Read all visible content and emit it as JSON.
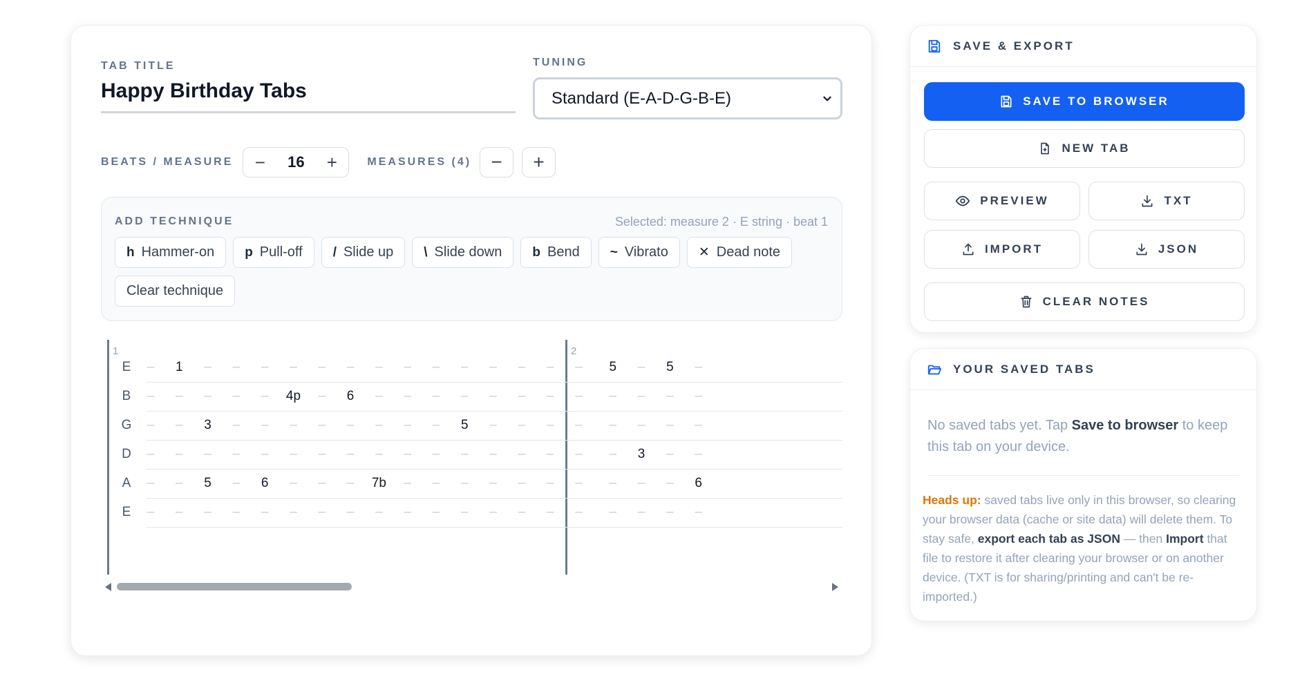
{
  "editor": {
    "title_label": "TAB TITLE",
    "title_value": "Happy Birthday Tabs",
    "tuning_label": "TUNING",
    "tuning_value": "Standard (E-A-D-G-B-E)",
    "beats_label": "BEATS / MEASURE",
    "beats_value": "16",
    "measures_label": "MEASURES (4)",
    "technique": {
      "heading": "ADD TECHNIQUE",
      "selected": "Selected: measure 2 · E string · beat 1",
      "buttons": [
        {
          "sym": "h",
          "label": "Hammer-on"
        },
        {
          "sym": "p",
          "label": "Pull-off"
        },
        {
          "sym": "/",
          "label": "Slide up"
        },
        {
          "sym": "\\",
          "label": "Slide down"
        },
        {
          "sym": "b",
          "label": "Bend"
        },
        {
          "sym": "~",
          "label": "Vibrato"
        },
        {
          "sym": "✕",
          "label": "Dead note"
        }
      ],
      "clear": "Clear technique"
    },
    "tab": {
      "measure_numbers": [
        "1",
        "2"
      ],
      "strings": [
        "E",
        "B",
        "G",
        "D",
        "A",
        "E"
      ],
      "empty_mark": "–",
      "rows": [
        [
          "",
          "1",
          "",
          "",
          "",
          "",
          "",
          "",
          "",
          "",
          "",
          "",
          "",
          "",
          "",
          "",
          "5",
          "",
          "5",
          ""
        ],
        [
          "",
          "",
          "",
          "",
          "",
          "4p",
          "",
          "6",
          "",
          "",
          "",
          "",
          "",
          "",
          "",
          "",
          "",
          "",
          "",
          ""
        ],
        [
          "",
          "",
          "3",
          "",
          "",
          "",
          "",
          "",
          "",
          "",
          "",
          "5",
          "",
          "",
          "",
          "",
          "",
          "",
          "",
          ""
        ],
        [
          "",
          "",
          "",
          "",
          "",
          "",
          "",
          "",
          "",
          "",
          "",
          "",
          "",
          "",
          "",
          "",
          "",
          "3",
          "",
          ""
        ],
        [
          "",
          "",
          "5",
          "",
          "6",
          "",
          "",
          "",
          "7b",
          "",
          "",
          "",
          "",
          "",
          "",
          "",
          "",
          "",
          "",
          "6"
        ],
        [
          "",
          "",
          "",
          "",
          "",
          "",
          "",
          "",
          "",
          "",
          "",
          "",
          "",
          "",
          "",
          "",
          "",
          "",
          "",
          ""
        ]
      ]
    }
  },
  "save": {
    "heading": "SAVE & EXPORT",
    "save_browser": "SAVE TO BROWSER",
    "new_tab": "NEW TAB",
    "preview": "PREVIEW",
    "txt": "TXT",
    "import": "IMPORT",
    "json": "JSON",
    "clear_notes": "CLEAR NOTES"
  },
  "saved": {
    "heading": "YOUR SAVED TABS",
    "empty_pre": "No saved tabs yet. Tap ",
    "empty_bold": "Save to browser",
    "empty_post": " to keep this tab on your device.",
    "hu_label": "Heads up:",
    "hu_1": " saved tabs live only in this browser, so clearing your browser data (cache or site data) will delete them. To stay safe, ",
    "hu_bold1": "export each tab as JSON",
    "hu_2": " — then ",
    "hu_bold2": "Import",
    "hu_3": " that file to restore it after clearing your browser or on another device. (TXT is for sharing/printing and can't be re-imported.)"
  },
  "colors": {
    "accent": "#1460f2",
    "warning": "#d97706"
  }
}
